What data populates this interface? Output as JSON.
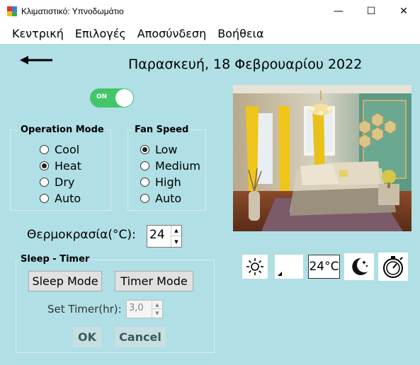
{
  "window": {
    "title": "Κλιματιστικό: Υπνοδωμάτιο",
    "minimize": "—",
    "maximize": "☐",
    "close": "✕"
  },
  "menu": [
    "Κεντρική",
    "Επιλογές",
    "Αποσύνδεση",
    "Βοήθεια"
  ],
  "date": "Παρασκευή, 18 Φεβρουαρίου 2022",
  "power_toggle": {
    "label": "ON",
    "state": "on"
  },
  "operation_mode": {
    "title": "Operation Mode",
    "options": [
      "Cool",
      "Heat",
      "Dry",
      "Auto"
    ],
    "selected": "Heat"
  },
  "fan_speed": {
    "title": "Fan Speed",
    "options": [
      "Low",
      "Medium",
      "High",
      "Auto"
    ],
    "selected": "Low"
  },
  "temperature": {
    "label": "Θερμοκρασία(°C):",
    "value": "24"
  },
  "sleep_timer": {
    "title": "Sleep - Timer",
    "sleep_button": "Sleep Mode",
    "timer_button": "Timer Mode",
    "set_timer_label": "Set Timer(hr):",
    "set_timer_value": "3,0"
  },
  "actions": {
    "ok": "OK",
    "cancel": "Cancel"
  },
  "status": {
    "temperature_display": "24°C"
  },
  "colors": {
    "background": "#b0dfe5",
    "toggle_on": "#43c56a"
  }
}
